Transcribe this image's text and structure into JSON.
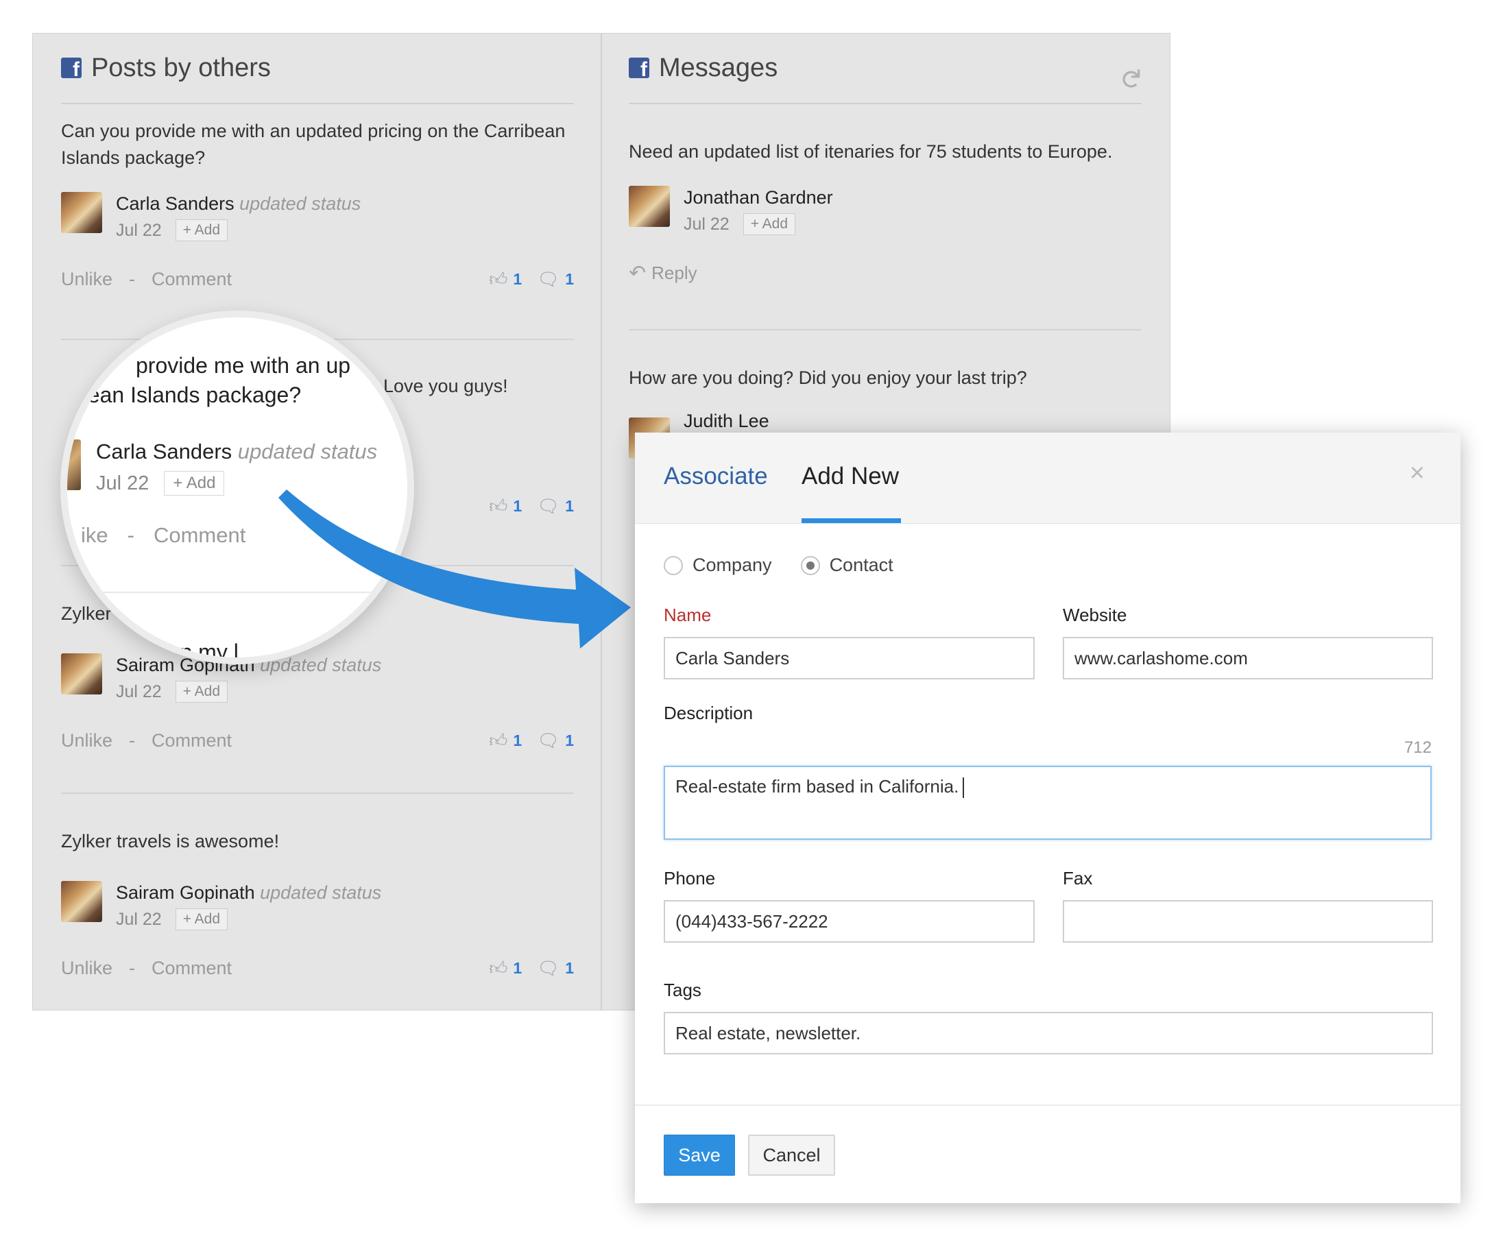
{
  "posts_panel": {
    "title": "Posts by others",
    "posts": [
      {
        "text": "Can you provide me with an updated pricing on the Carribean Islands package?",
        "author": "Carla Sanders",
        "activity": "updated status",
        "date": "Jul 22",
        "add": "+ Add",
        "likes": "1",
        "comments": "1"
      },
      {
        "text": "Love you guys!",
        "author": "",
        "activity": "",
        "date": "",
        "add": "",
        "likes": "1",
        "comments": "1"
      },
      {
        "text": "Zylker",
        "author": "Sairam Gopinath",
        "activity": "updated status",
        "date": "Jul 22",
        "add": "+ Add",
        "likes": "1",
        "comments": "1"
      },
      {
        "text": "Zylker travels is awesome!",
        "author": "Sairam Gopinath",
        "activity": "updated status",
        "date": "Jul 22",
        "add": "+ Add",
        "likes": "1",
        "comments": "1"
      }
    ],
    "unlike_label": "Unlike",
    "comment_label": "Comment",
    "separator": "-"
  },
  "messages_panel": {
    "title": "Messages",
    "messages": [
      {
        "text": "Need an updated list of itenaries for 75 students to Europe.",
        "author": "Jonathan Gardner",
        "date": "Jul 22",
        "add": "+ Add"
      },
      {
        "text": "How are you doing? Did you enjoy your last trip?",
        "author": "Judith Lee"
      }
    ],
    "reply_label": "Reply"
  },
  "magnifier": {
    "line1": "provide me with an up",
    "line2": "Ha  ean Islands package?",
    "author": "Carla Sanders",
    "activity": "updated status",
    "date": "Jul 22",
    "add": "+ Add",
    "unlike": "ike",
    "separator": "-",
    "comment": "Comment",
    "bottom": "n on my l"
  },
  "modal": {
    "tabs": {
      "associate": "Associate",
      "add_new": "Add New"
    },
    "close": "×",
    "radio": {
      "company": "Company",
      "contact": "Contact",
      "selected": "Contact"
    },
    "fields": {
      "name_label": "Name",
      "name_value": "Carla Sanders",
      "website_label": "Website",
      "website_value": "www.carlashome.com",
      "description_label": "Description",
      "description_value": "Real-estate firm based in California.",
      "char_count": "712",
      "phone_label": "Phone",
      "phone_value": "(044)433-567-2222",
      "fax_label": "Fax",
      "fax_value": "",
      "tags_label": "Tags",
      "tags_value": "Real estate, newsletter."
    },
    "save_label": "Save",
    "cancel_label": "Cancel"
  },
  "colors": {
    "accent": "#2d8fe0",
    "facebook": "#3b5998",
    "required": "#b8312f",
    "count": "#2f7bd6"
  }
}
